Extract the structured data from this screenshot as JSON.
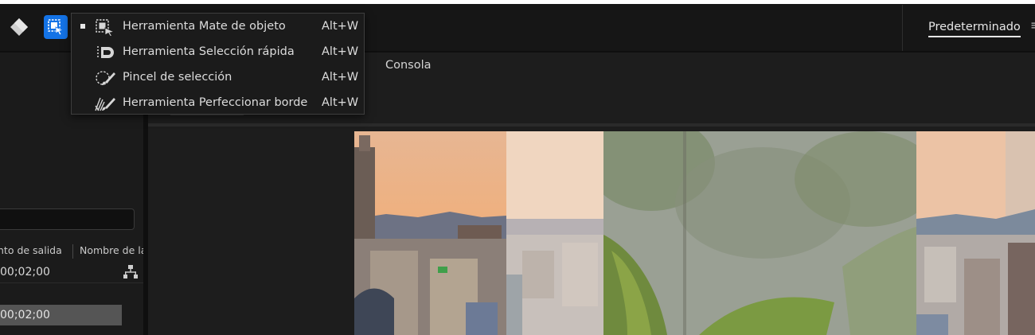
{
  "toolbar": {
    "tools": [
      {
        "icon": "eraser-icon"
      },
      {
        "icon": "object-matte-tool-icon",
        "active": true
      }
    ]
  },
  "workspace": {
    "label": "Predeterminado",
    "more_icon": "chevron-more-icon"
  },
  "tool_menu": {
    "items": [
      {
        "label": "Herramienta Mate de objeto",
        "shortcut": "Alt+W",
        "icon": "object-matte-icon",
        "selected": true
      },
      {
        "label": "Herramienta Selección rápida",
        "shortcut": "Alt+W",
        "icon": "quick-selection-icon",
        "selected": false
      },
      {
        "label": "Pincel de selección",
        "shortcut": "Alt+W",
        "icon": "selection-brush-icon",
        "selected": false
      },
      {
        "label": "Herramienta Perfeccionar borde",
        "shortcut": "Alt+W",
        "icon": "refine-edge-icon",
        "selected": false
      }
    ]
  },
  "panel": {
    "tab_label": "Consola"
  },
  "project_panel": {
    "columns": [
      "nto de salida",
      "Nombre de la"
    ],
    "rows": [
      {
        "timecode": "00;02;00"
      },
      {
        "timecode": "00;02;00",
        "selected": true
      }
    ]
  },
  "colors": {
    "accent": "#1473e6",
    "background": "#1d1d1d",
    "menu_bg": "#1b1b1b"
  }
}
